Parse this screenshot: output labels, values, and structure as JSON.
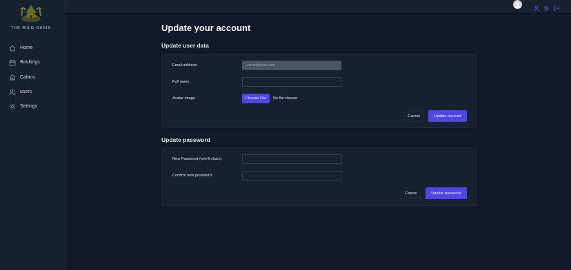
{
  "brand": {
    "name": "THE WILD OASIS"
  },
  "sidebar": {
    "items": [
      {
        "label": "Home",
        "icon": "home-icon"
      },
      {
        "label": "Bookings",
        "icon": "calendar-icon"
      },
      {
        "label": "Cabins",
        "icon": "cabin-icon"
      },
      {
        "label": "users",
        "icon": "users-icon"
      },
      {
        "label": "Settings",
        "icon": "gear-icon"
      }
    ]
  },
  "header": {
    "icons": [
      "user-icon",
      "sun-icon",
      "logout-icon"
    ]
  },
  "page": {
    "title": "Update your account"
  },
  "user_data": {
    "title": "Update user data",
    "email_label": "Email address",
    "email_value": "admin@test.com",
    "fullname_label": "Full name",
    "fullname_value": "",
    "avatar_label": "Avatar image",
    "file_button": "Choose File",
    "file_status": "No file chosen",
    "cancel_label": "Cancel",
    "submit_label": "Update account"
  },
  "password": {
    "title": "Update password",
    "new_label": "New Password (min 8 chars)",
    "confirm_label": "Confirm new password",
    "cancel_label": "Cancel",
    "submit_label": "Update password"
  },
  "colors": {
    "background": "#111827",
    "panel": "#18212f",
    "accent": "#4f46e5",
    "border": "#374151"
  }
}
